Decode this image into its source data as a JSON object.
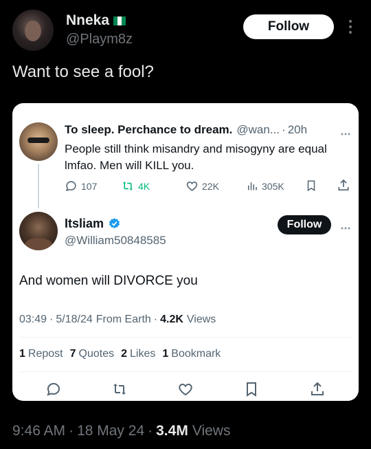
{
  "outer": {
    "author_name": "Nneka",
    "flag_emoji": "🇳🇬",
    "handle": "@Playm8z",
    "follow_label": "Follow",
    "text": "Want to see a fool?",
    "footer": {
      "time": "9:46 AM",
      "date": "18 May 24",
      "views": "3.4M",
      "views_label": "Views"
    }
  },
  "quoted": {
    "parent": {
      "name": "To sleep. Perchance to dream.",
      "handle": "@wan...",
      "time": "20h",
      "text": "People still think misandry and misogyny are equal lmfao. Men will KILL you.",
      "stats": {
        "replies": "107",
        "reposts": "4K",
        "likes": "22K",
        "views": "305K"
      }
    },
    "reply": {
      "name": "Itsliam",
      "handle": "@William50848585",
      "follow_label": "Follow",
      "text": "And women will DIVORCE you",
      "meta": {
        "time": "03:49",
        "date": "5/18/24",
        "source": "From Earth",
        "views": "4.2K",
        "views_label": "Views"
      },
      "engagement": {
        "reposts": "1",
        "reposts_label": "Repost",
        "quotes": "7",
        "quotes_label": "Quotes",
        "likes": "2",
        "likes_label": "Likes",
        "bookmarks": "1",
        "bookmarks_label": "Bookmark"
      }
    }
  },
  "colors": {
    "verified": "#1d9bf0",
    "repost_green": "#00ba7c",
    "muted": "#536471",
    "card_bg": "#ffffff",
    "bg": "#000000"
  }
}
